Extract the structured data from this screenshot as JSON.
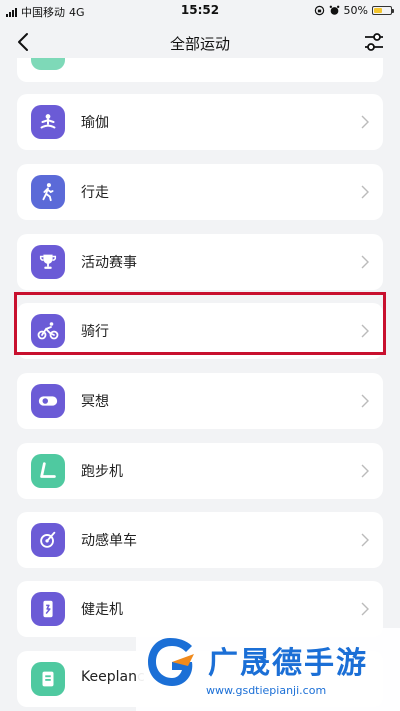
{
  "status_bar": {
    "carrier": "中国移动",
    "network": "4G",
    "time": "15:52",
    "battery_percent": "50%",
    "battery_level": 0.5
  },
  "nav": {
    "title": "全部运动",
    "back_icon": "chevron-left-icon",
    "filter_icon": "sliders-icon"
  },
  "colors": {
    "highlight": "#c8102e",
    "icon_purple": "#6b5bd6",
    "icon_green": "#4fc9a0"
  },
  "items": [
    {
      "label": "瑜伽",
      "icon": "yoga-icon"
    },
    {
      "label": "行走",
      "icon": "walking-icon"
    },
    {
      "label": "活动赛事",
      "icon": "trophy-icon"
    },
    {
      "label": "骑行",
      "icon": "cycling-icon",
      "highlighted": true
    },
    {
      "label": "冥想",
      "icon": "meditation-icon"
    },
    {
      "label": "跑步机",
      "icon": "treadmill-icon"
    },
    {
      "label": "动感单车",
      "icon": "spin-bike-icon"
    },
    {
      "label": "健走机",
      "icon": "walking-machine-icon"
    },
    {
      "label": "Keeplanc",
      "icon": "keepland-icon"
    }
  ],
  "watermark": {
    "name": "广晟德手游",
    "url": "www.gsdtiepianji.com"
  }
}
